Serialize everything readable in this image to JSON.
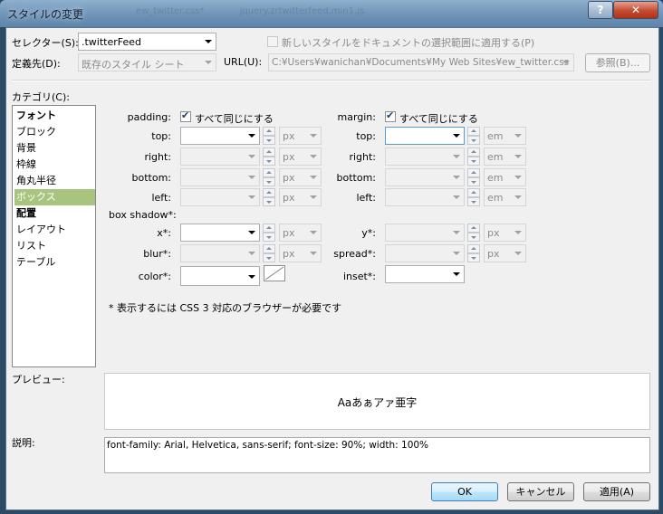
{
  "window": {
    "title": "スタイルの変更",
    "bg_tabs": [
      "ew_twitter.css*",
      "jquery.zrtwitterfeed.min1.js"
    ]
  },
  "header": {
    "selector_label": "セレクター(S):",
    "selector_value": ".twitterFeed",
    "new_style_checkbox": "新しいスタイルをドキュメントの選択範囲に適用する(P)",
    "define_in_label": "定義先(D):",
    "define_in_value": "既存のスタイル シート",
    "url_label": "URL(U):",
    "url_value": "C:¥Users¥wanichan¥Documents¥My Web Sites¥ew_twitter.css",
    "browse_button": "参照(B)..."
  },
  "category": {
    "label": "カテゴリ(C):",
    "items": [
      {
        "label": "フォント",
        "bold": true
      },
      {
        "label": "ブロック",
        "bold": false
      },
      {
        "label": "背景",
        "bold": false
      },
      {
        "label": "枠線",
        "bold": false
      },
      {
        "label": "角丸半径",
        "bold": false
      },
      {
        "label": "ボックス",
        "bold": false,
        "selected": true
      },
      {
        "label": "配置",
        "bold": true
      },
      {
        "label": "レイアウト",
        "bold": false
      },
      {
        "label": "リスト",
        "bold": false
      },
      {
        "label": "テーブル",
        "bold": false
      }
    ]
  },
  "box": {
    "padding_label": "padding:",
    "margin_label": "margin:",
    "same_for_all": "すべて同じにする",
    "top": "top:",
    "right": "right:",
    "bottom": "bottom:",
    "left": "left:",
    "unit_px": "px",
    "unit_em": "em",
    "box_shadow_label": "box shadow*:",
    "x": "x*:",
    "y": "y*:",
    "blur": "blur*:",
    "spread": "spread*:",
    "color": "color*:",
    "inset": "inset*:",
    "css3_note": "* 表示するには CSS 3 対応のブラウザーが必要です"
  },
  "preview": {
    "label": "プレビュー:",
    "sample": "Aaあぁアァ亜字"
  },
  "description": {
    "label": "説明:",
    "text": "font-family: Arial, Helvetica, sans-serif; font-size: 90%; width: 100%"
  },
  "footer": {
    "ok": "OK",
    "cancel": "キャンセル",
    "apply": "適用(A)"
  }
}
